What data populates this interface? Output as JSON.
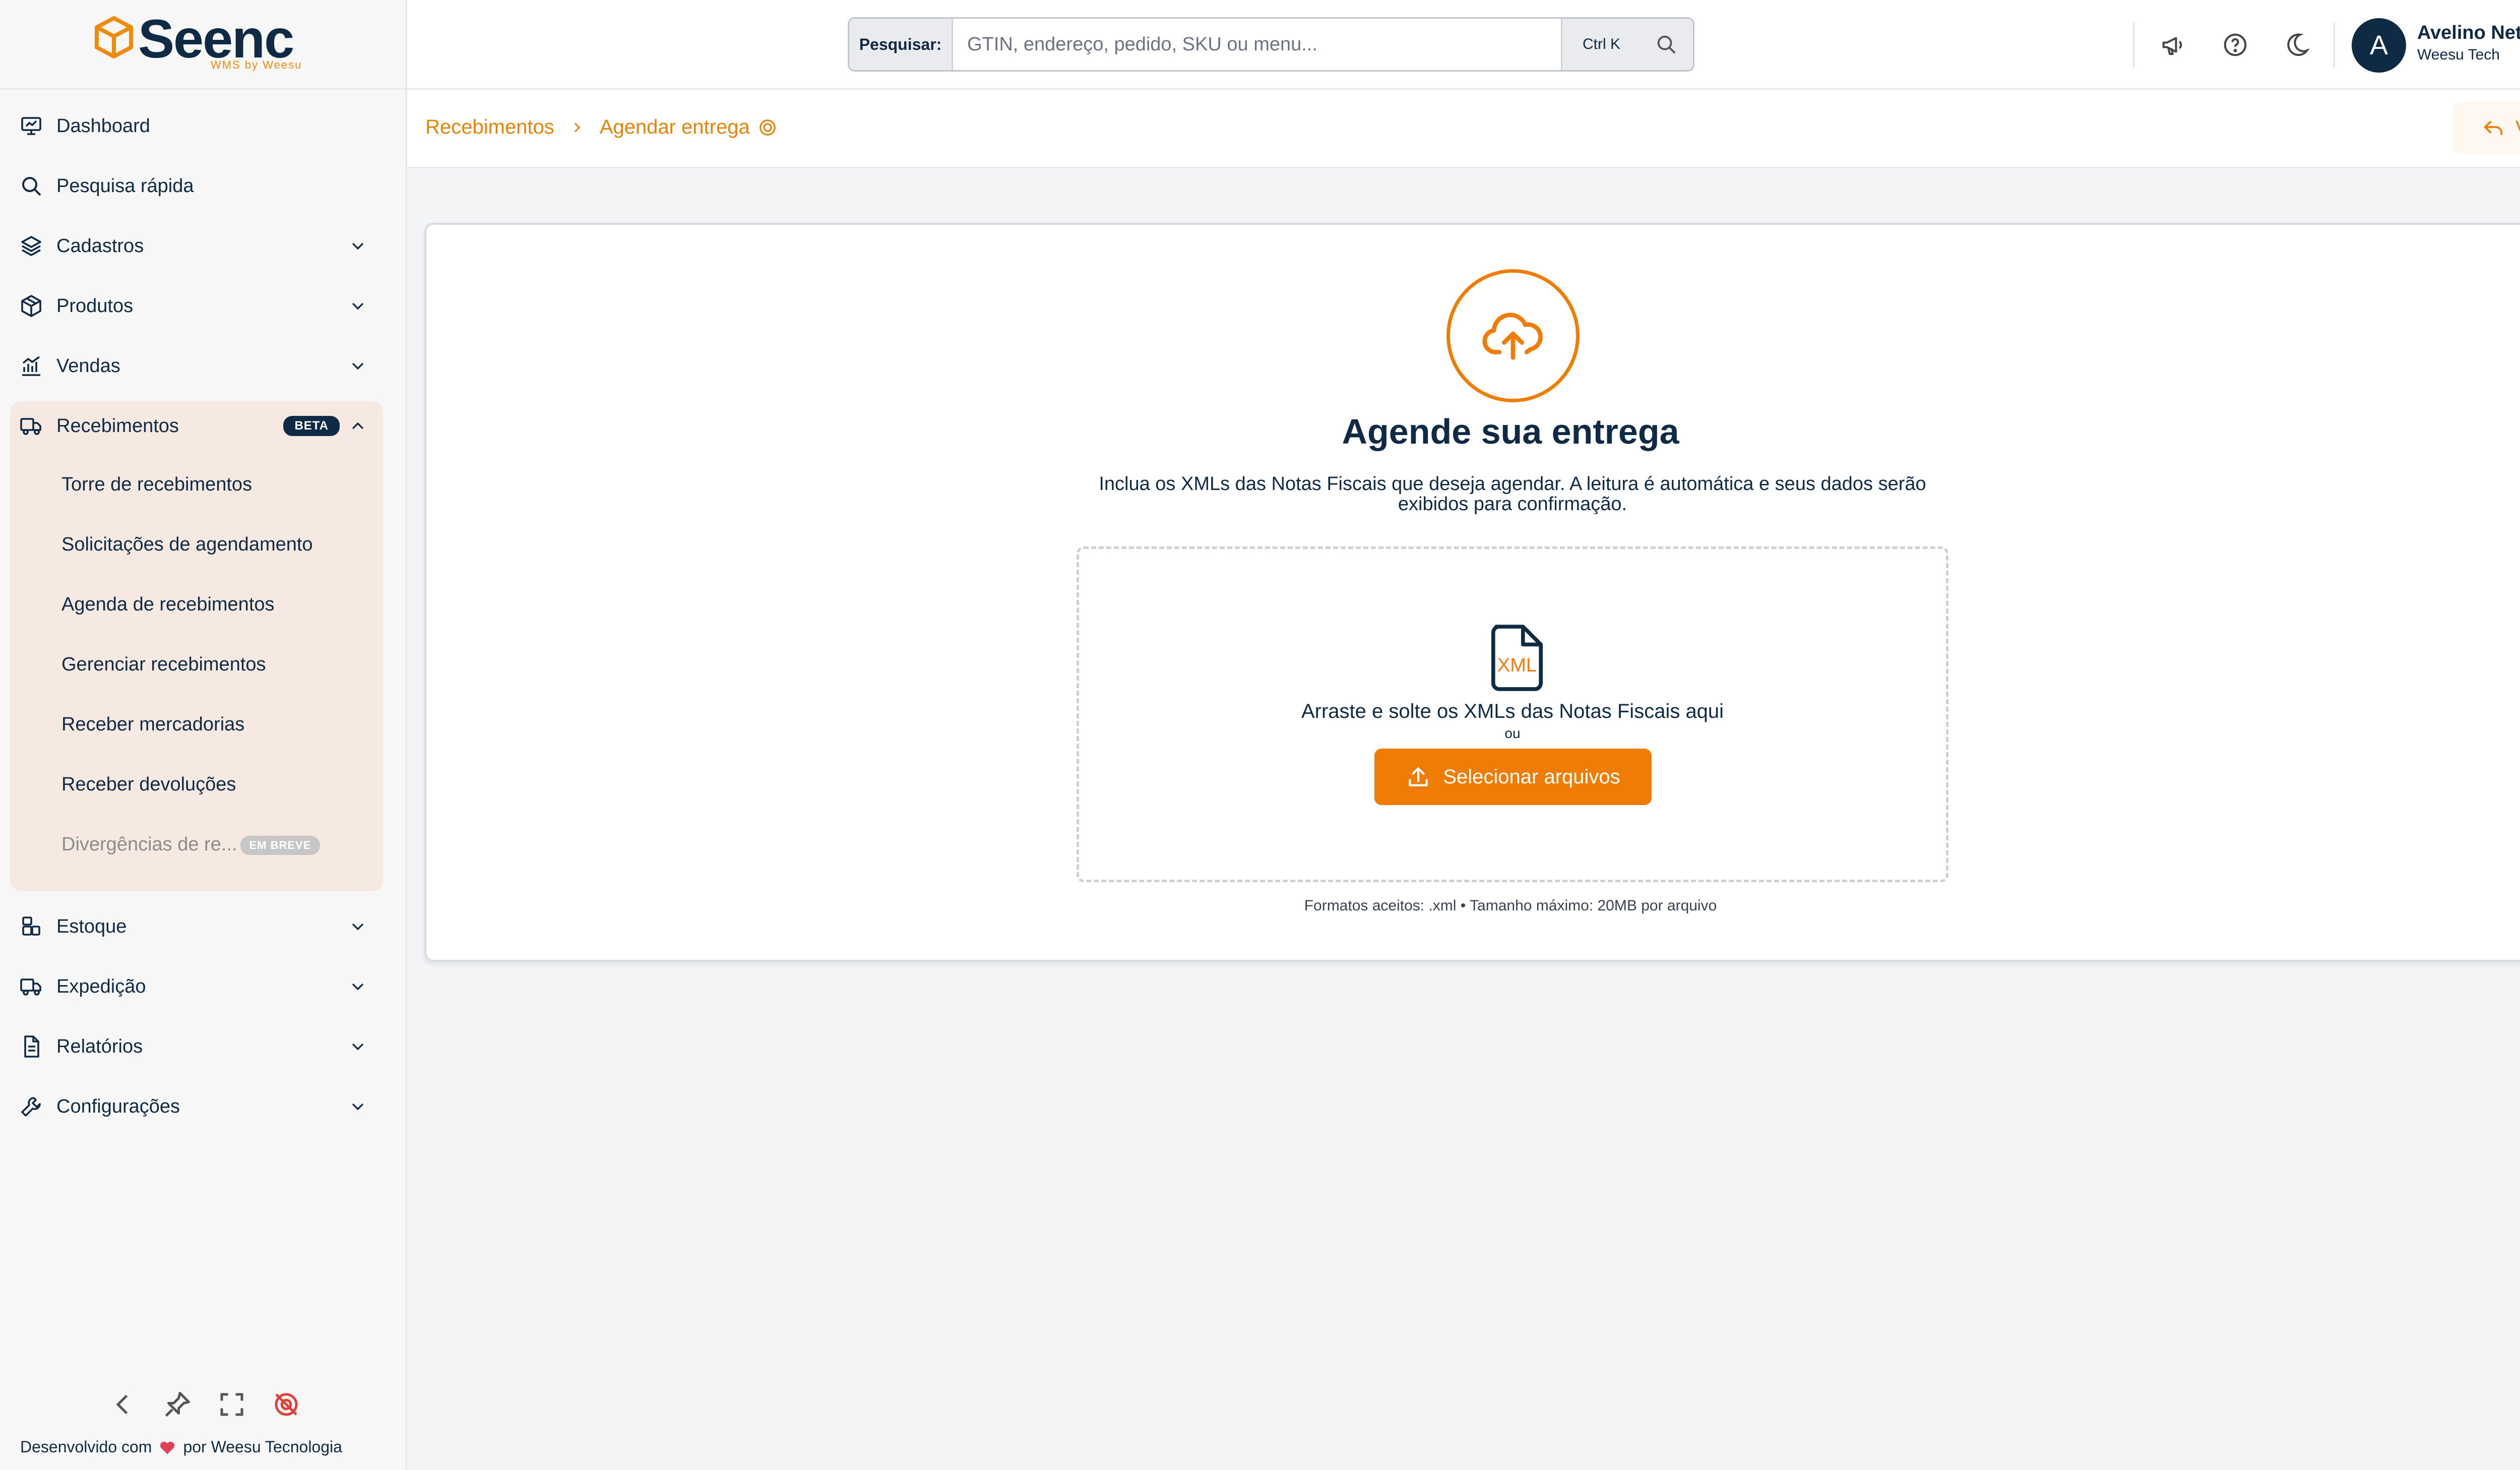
{
  "brand": {
    "name": "Seenc",
    "sub": "WMS by Weesu"
  },
  "search": {
    "prefix": "Pesquisar:",
    "placeholder": "GTIN, endereço, pedido, SKU ou menu...",
    "shortcut": "Ctrl K"
  },
  "user": {
    "initial": "A",
    "name": "Avelino Neto",
    "org": "Weesu Tech"
  },
  "sidebar": {
    "items": [
      {
        "label": "Dashboard",
        "icon": "dashboard-icon"
      },
      {
        "label": "Pesquisa rápida",
        "icon": "search-icon"
      },
      {
        "label": "Cadastros",
        "icon": "layers-icon"
      },
      {
        "label": "Produtos",
        "icon": "package-icon"
      },
      {
        "label": "Vendas",
        "icon": "chart-icon"
      },
      {
        "label": "Recebimentos",
        "icon": "truck-icon",
        "badge": "BETA"
      },
      {
        "label": "Estoque",
        "icon": "warehouse-icon"
      },
      {
        "label": "Expedição",
        "icon": "truck-icon"
      },
      {
        "label": "Relatórios",
        "icon": "report-icon"
      },
      {
        "label": "Configurações",
        "icon": "wrench-icon"
      }
    ],
    "sub_items": [
      "Torre de recebimentos",
      "Solicitações de agendamento",
      "Agenda de recebimentos",
      "Gerenciar recebimentos",
      "Receber mercadorias",
      "Receber devoluções",
      "Divergências de re..."
    ],
    "soon_badge": "EM BREVE",
    "footer": {
      "prefix": "Desenvolvido com",
      "suffix": "por Weesu Tecnologia"
    }
  },
  "breadcrumb": {
    "parent": "Recebimentos",
    "current": "Agendar entrega"
  },
  "back_label": "Voltar",
  "card": {
    "title": "Agende sua entrega",
    "description": "Inclua os XMLs das Notas Fiscais que deseja agendar. A leitura é automática e seus dados serão exibidos para confirmação.",
    "dropzone_text": "Arraste e solte os XMLs das Notas Fiscais aqui",
    "or_text": "ou",
    "select_label": "Selecionar arquivos",
    "file_badge": "XML",
    "formats": "Formatos aceitos: .xml • Tamanho máximo: 20MB por arquivo"
  },
  "colors": {
    "accent": "#ef7d05",
    "navy": "#0f2a44",
    "highlight": "#f5e9e2"
  }
}
